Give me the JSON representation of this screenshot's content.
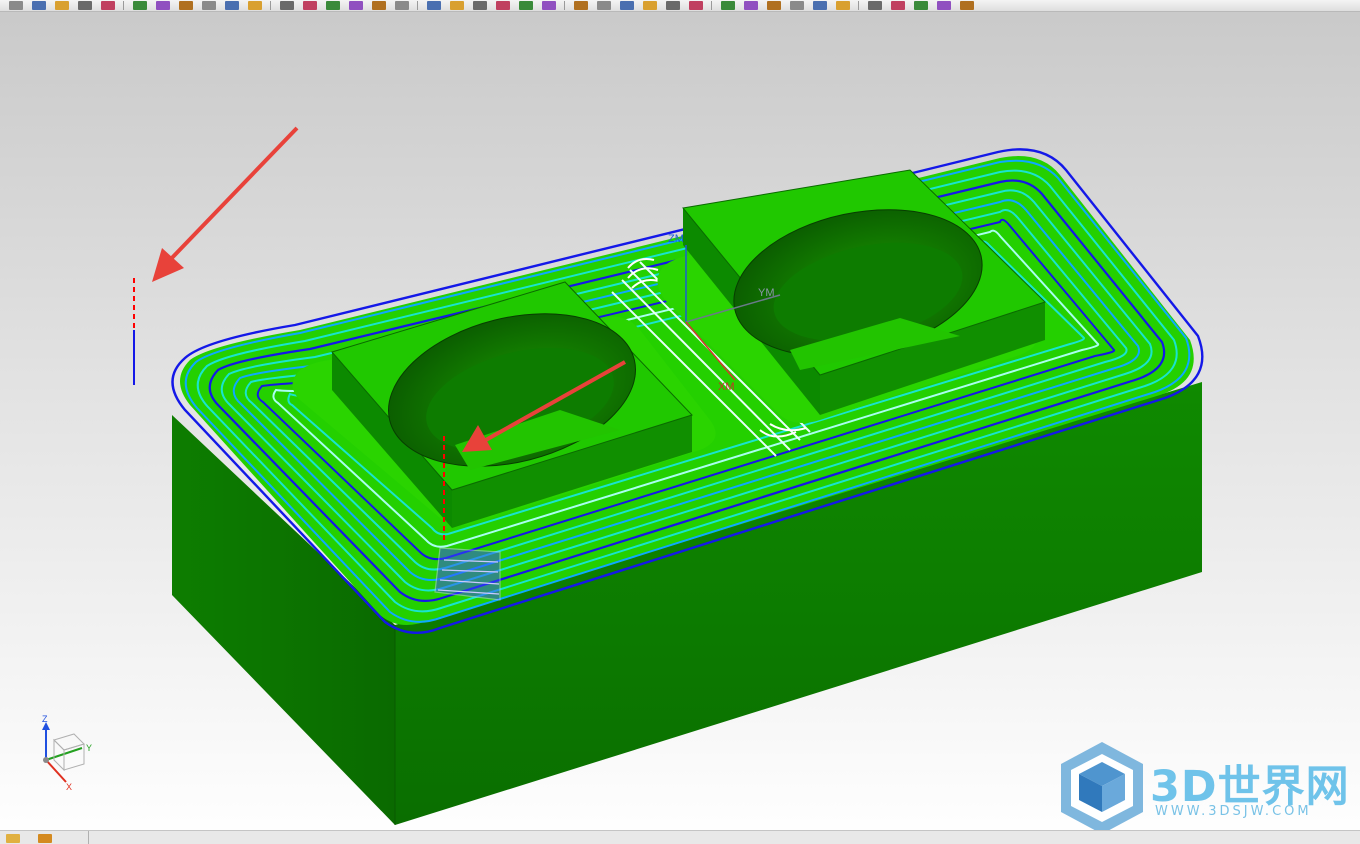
{
  "toolbar": {
    "button_count": 40
  },
  "viewport": {
    "wcs_labels": {
      "z": "ZM",
      "y": "YM",
      "x": "XM"
    },
    "triad_labels": {
      "z": "Z",
      "y": "Y",
      "x": "X"
    }
  },
  "watermark": {
    "brand": "3D世界网",
    "url": "WWW.3DSJW.COM"
  },
  "colors": {
    "part_green": "#22cc00",
    "part_dark": "#0b7a00",
    "toolpath_cyan": "#19e4cf",
    "toolpath_blue": "#0a10e6",
    "annotation_red": "#e8423a",
    "watermark_blue": "#6fc3ea"
  }
}
